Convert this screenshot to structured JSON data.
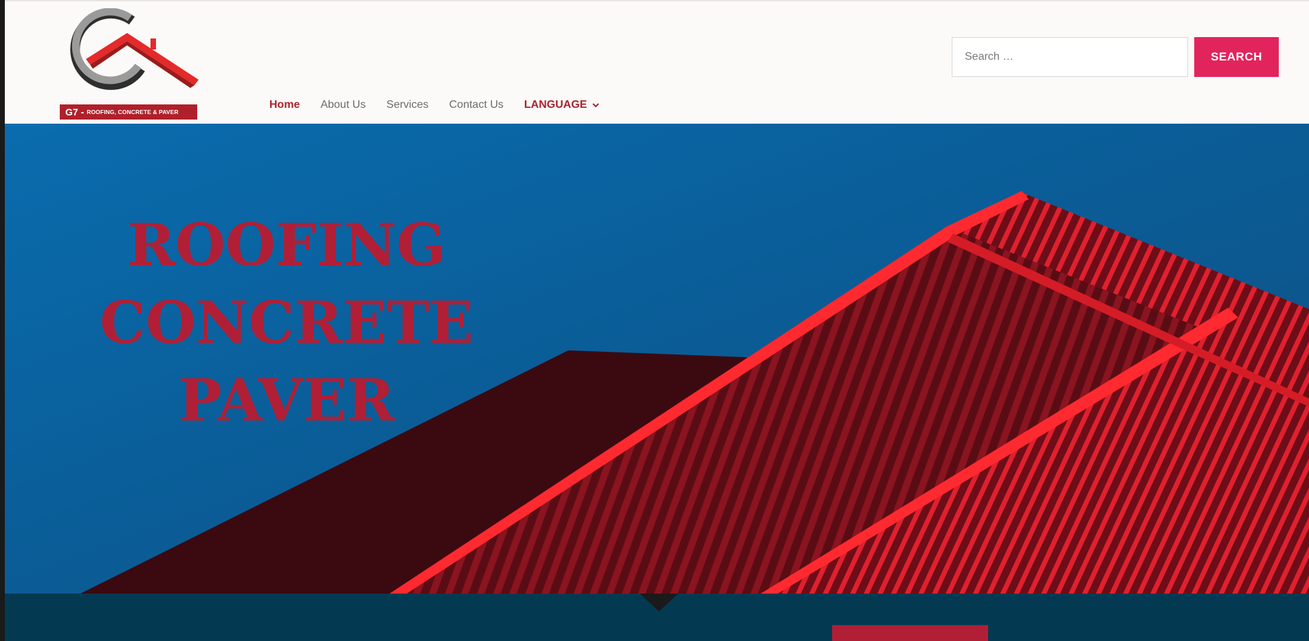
{
  "logo": {
    "mark": "G7 -",
    "tagline": "ROOFING, CONCRETE & PAVER"
  },
  "nav": {
    "items": [
      {
        "label": "Home"
      },
      {
        "label": "About Us"
      },
      {
        "label": "Services"
      },
      {
        "label": "Contact Us"
      },
      {
        "label": "LANGUAGE"
      }
    ]
  },
  "search": {
    "placeholder": "Search …",
    "button_label": "SEARCH"
  },
  "hero": {
    "line1": "ROOFING",
    "line2": "CONCRETE",
    "line3": "PAVER"
  },
  "colors": {
    "accent": "#e2245d",
    "brand_red": "#a8232d",
    "hero_sky": "#0a6cae",
    "band": "#033a52"
  }
}
